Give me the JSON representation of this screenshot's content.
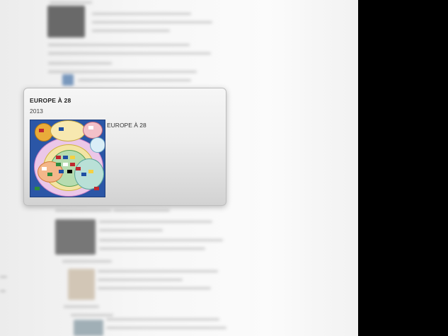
{
  "card": {
    "title": "EUROPE À 28",
    "year": "2013",
    "caption": "EUROPE À 28",
    "thumbnail_icon": "euler-diagram-thumbnail"
  },
  "colors": {
    "page_bg": "#f5f5f5",
    "side_bar": "#000000",
    "thumb_bg": "#2b56a6",
    "card_top": "#f6f6f6",
    "card_bottom": "#d2d2d2"
  }
}
